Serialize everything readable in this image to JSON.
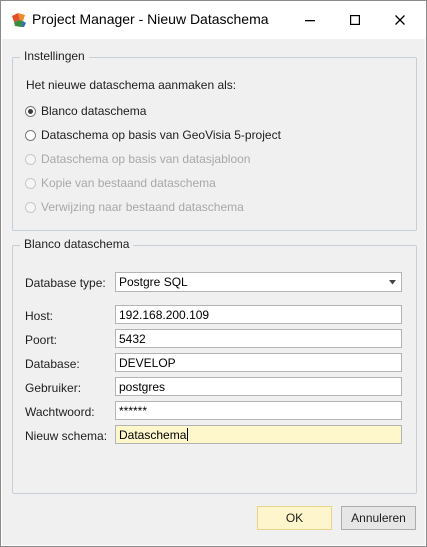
{
  "window": {
    "title": "Project Manager - Nieuw Dataschema",
    "icon": "project-manager-app-icon",
    "controls": [
      "minimize-icon",
      "maximize-icon",
      "close-icon"
    ]
  },
  "settings_group": {
    "label": "Instellingen",
    "prompt": "Het nieuwe dataschema aanmaken als:",
    "options": [
      {
        "label": "Blanco dataschema",
        "checked": true,
        "enabled": true
      },
      {
        "label": "Dataschema op basis van GeoVisia 5-project",
        "checked": false,
        "enabled": true
      },
      {
        "label": "Dataschema op basis van datasjabloon",
        "checked": false,
        "enabled": false
      },
      {
        "label": "Kopie van bestaand dataschema",
        "checked": false,
        "enabled": false
      },
      {
        "label": "Verwijzing naar bestaand dataschema",
        "checked": false,
        "enabled": false
      }
    ]
  },
  "blank_group": {
    "label": "Blanco dataschema",
    "database_type": {
      "label": "Database type:",
      "value": "Postgre SQL"
    },
    "host": {
      "label": "Host:",
      "value": "192.168.200.109"
    },
    "port": {
      "label": "Poort:",
      "value": "5432"
    },
    "database": {
      "label": "Database:",
      "value": "DEVELOP"
    },
    "user": {
      "label": "Gebruiker:",
      "value": "postgres"
    },
    "password": {
      "label": "Wachtwoord:",
      "value": "******"
    },
    "schema": {
      "label": "Nieuw schema:",
      "value": "Dataschema"
    }
  },
  "buttons": {
    "ok": "OK",
    "cancel": "Annuleren"
  },
  "colors": {
    "dialog_background": "#f0f0f0",
    "focused_field": "#fff7cc",
    "default_button": "#fff5cc",
    "group_border": "#c6cfd9"
  }
}
